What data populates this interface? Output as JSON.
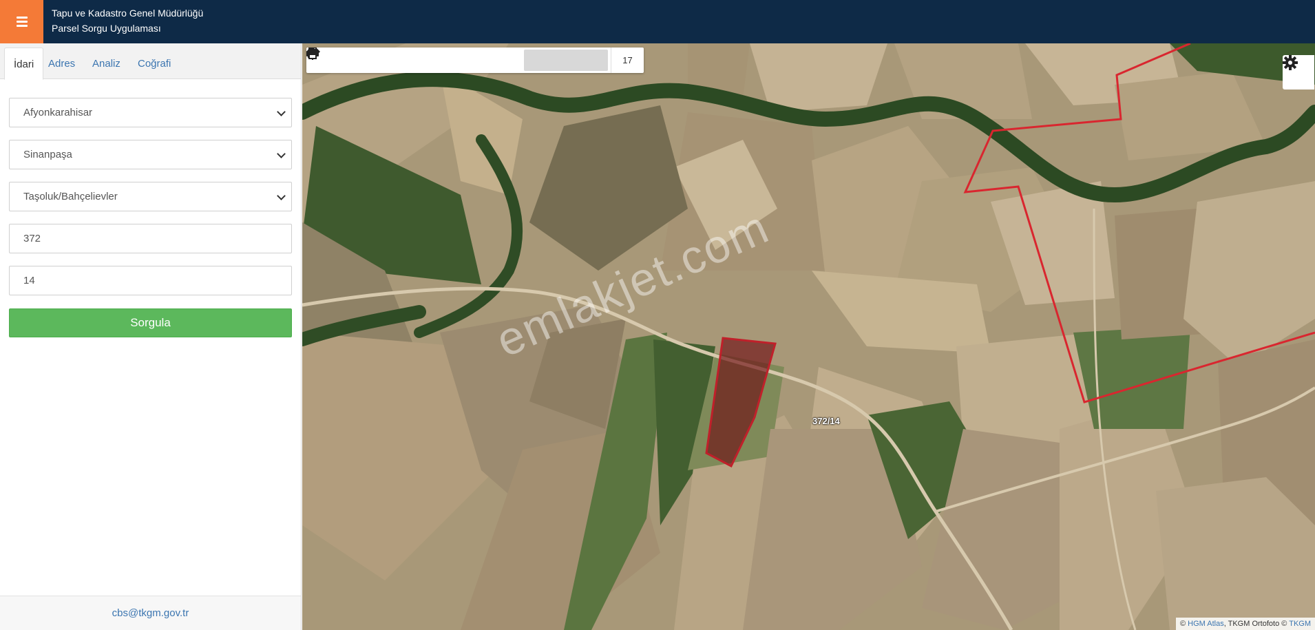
{
  "header": {
    "org_title": "Tapu ve Kadastro Genel Müdürlüğü",
    "app_title": "Parsel Sorgu Uygulaması",
    "menu_icon": "hamburger-icon",
    "menu_color": "#f47a37",
    "bar_color": "#0e2a47"
  },
  "sidebar": {
    "tabs": [
      {
        "label": "İdari",
        "active": true
      },
      {
        "label": "Adres",
        "active": false
      },
      {
        "label": "Analiz",
        "active": false
      },
      {
        "label": "Coğrafi",
        "active": false
      }
    ],
    "province_select": "Afyonkarahisar",
    "district_select": "Sinanpaşa",
    "neighborhood_select": "Taşoluk/Bahçelievler",
    "block_input": "372",
    "parcel_input": "14",
    "query_button": "Sorgula",
    "query_button_color": "#5cb85c",
    "footer_email": "cbs@tkgm.gov.tr"
  },
  "map": {
    "toolbar": [
      {
        "icon": "zoom-in-icon"
      },
      {
        "icon": "zoom-out-icon"
      },
      {
        "icon": "refresh-icon"
      },
      {
        "icon": "locate-icon"
      },
      {
        "icon": "info-icon"
      },
      {
        "icon": "star-icon"
      },
      {
        "icon": "measure-icon"
      },
      {
        "icon": "print-icon"
      }
    ],
    "zoom_level": "17",
    "settings_icon": "gear-icon",
    "watermark": "emlakjet.com",
    "parcel_label": "372/14",
    "parcel_color": "#c0202a",
    "attribution_prefix": "© ",
    "attribution_link1": "HGM Atlas",
    "attribution_middle": ", TKGM Ortofoto © ",
    "attribution_link2": "TKGM"
  }
}
